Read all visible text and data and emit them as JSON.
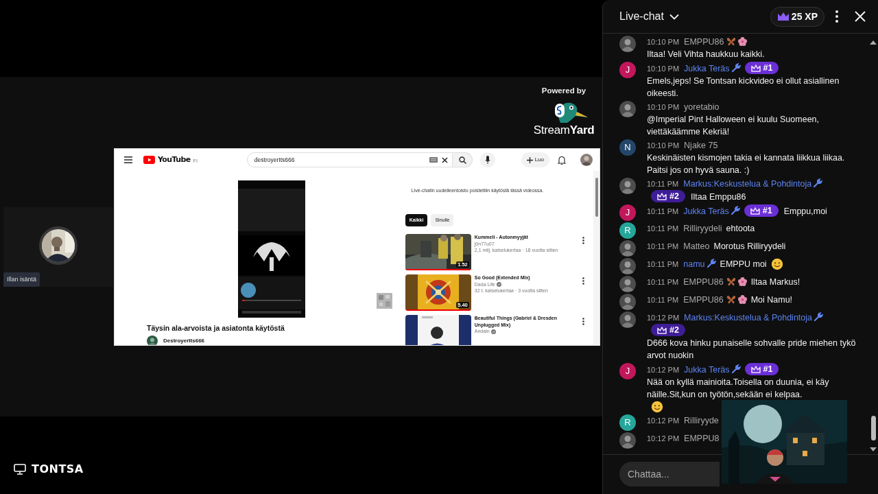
{
  "stage": {
    "branding": {
      "caption": "Powered by",
      "wordmark": "Stream**Yard**"
    },
    "participant": {
      "name_tag": "Illan isäntä"
    },
    "shared_screen": {
      "logo": "YouTube",
      "country": "FI",
      "search_value": "destroyerIts666",
      "create_label": "Luo",
      "video_title": "Täysin ala-arvoista ja asiatonta käytöstä",
      "channel": "DestroyerIts666",
      "notice": "Live-chatin uudelleentoisto poistettiin käytöstä tässä videossa.",
      "chips": [
        {
          "label": "Kaikki",
          "selected": true
        },
        {
          "label": "Sinulle",
          "selected": false
        }
      ],
      "recommendations": [
        {
          "title": "Kummeli - Autonmyyjät",
          "channel": "j0n77u07",
          "verified": false,
          "meta": "2,1 milj. katselukertaa · 18 vuotta sitten",
          "duration": "1.52"
        },
        {
          "title": "So Good (Extended Mix)",
          "channel": "Dada Life",
          "verified": true,
          "meta": "32 t. katselukertaa · 3 vuotta sitten",
          "duration": "5.40"
        },
        {
          "title": "Beautiful Things (Gabriel & Dresden Unplugged Mix)",
          "channel": "Andain",
          "verified": true
        }
      ]
    },
    "source_label": "TONTSA"
  },
  "chat": {
    "title": "Live-chat",
    "xp": "25 XP",
    "messages": [
      {
        "time": "10:10 PM",
        "author": "EMPPU86",
        "kind": "member",
        "text": "Iltaa! Veli Vihta haukkuu kaikki."
      },
      {
        "time": "10:10 PM",
        "author": "Jukka Teräs",
        "kind": "moderator",
        "avatar": {
          "kind": "letter",
          "letter": "J",
          "color": "#c2185b"
        },
        "rank": {
          "label": "#1",
          "color": "#6b2fd6"
        },
        "text": "Emels,jeps! Se Tontsan kickvideo ei ollut asiallinen oikeesti."
      },
      {
        "time": "10:10 PM",
        "author": "yoretabio",
        "kind": "viewer",
        "text": "@Imperial Pint Halloween ei kuulu Suomeen, viettäkäämme Kekriä!"
      },
      {
        "time": "10:10 PM",
        "author": "Njake 75",
        "kind": "viewer",
        "avatar": {
          "kind": "letter",
          "letter": "N",
          "color": "#24466b"
        },
        "text": "Keskinäisten kismojen takia ei kannata liikkua liikaa. Paitsi jos on hyvä sauna. :)"
      },
      {
        "time": "10:11 PM",
        "author": "Markus:Keskustelua & Pohdintoja",
        "kind": "moderator",
        "rank": {
          "label": "#2",
          "color": "#3f1d96"
        },
        "text": "Iltaa Emppu86"
      },
      {
        "time": "10:11 PM",
        "author": "Jukka Teräs",
        "kind": "moderator",
        "avatar": {
          "kind": "letter",
          "letter": "J",
          "color": "#c2185b"
        },
        "rank": {
          "label": "#1",
          "color": "#6b2fd6"
        },
        "text": "Emppu,moi"
      },
      {
        "time": "10:11 PM",
        "author": "Rilliryydeli",
        "kind": "viewer",
        "avatar": {
          "kind": "letter",
          "letter": "R",
          "color": "#26a69a"
        },
        "text": "ehtoota"
      },
      {
        "time": "10:11 PM",
        "author": "Matteo",
        "kind": "viewer",
        "text": "Morotus Rilliryydeli"
      },
      {
        "time": "10:11 PM",
        "author": "namu",
        "kind": "moderator",
        "text": "EMPPU moi",
        "emoji": true
      },
      {
        "time": "10:11 PM",
        "author": "EMPPU86",
        "kind": "member",
        "text": "Iltaa Markus!"
      },
      {
        "time": "10:11 PM",
        "author": "EMPPU86",
        "kind": "member",
        "text": "Moi Namu!"
      },
      {
        "time": "10:12 PM",
        "author": "Markus:Keskustelua & Pohdintoja",
        "kind": "moderator",
        "rank": {
          "label": "#2",
          "color": "#3f1d96"
        },
        "text": "D666 kova hinku punaiselle sohvalle pride miehen tykö arvot nuokin"
      },
      {
        "time": "10:12 PM",
        "author": "Jukka Teräs",
        "kind": "moderator",
        "avatar": {
          "kind": "letter",
          "letter": "J",
          "color": "#c2185b"
        },
        "rank": {
          "label": "#1",
          "color": "#6b2fd6"
        },
        "text": "Nää on kyllä mainioita.Toisella on duunia, ei käy näille.Sit,kun on työtön,sekään ei kelpaa.",
        "emoji": true
      },
      {
        "time": "10:12 PM",
        "author": "Rilliryyde",
        "kind": "viewer",
        "avatar": {
          "kind": "letter",
          "letter": "R",
          "color": "#26a69a"
        }
      },
      {
        "time": "10:12 PM",
        "author": "EMPPU8",
        "kind": "viewer"
      }
    ],
    "input": {
      "placeholder": "Chattaa..."
    }
  }
}
